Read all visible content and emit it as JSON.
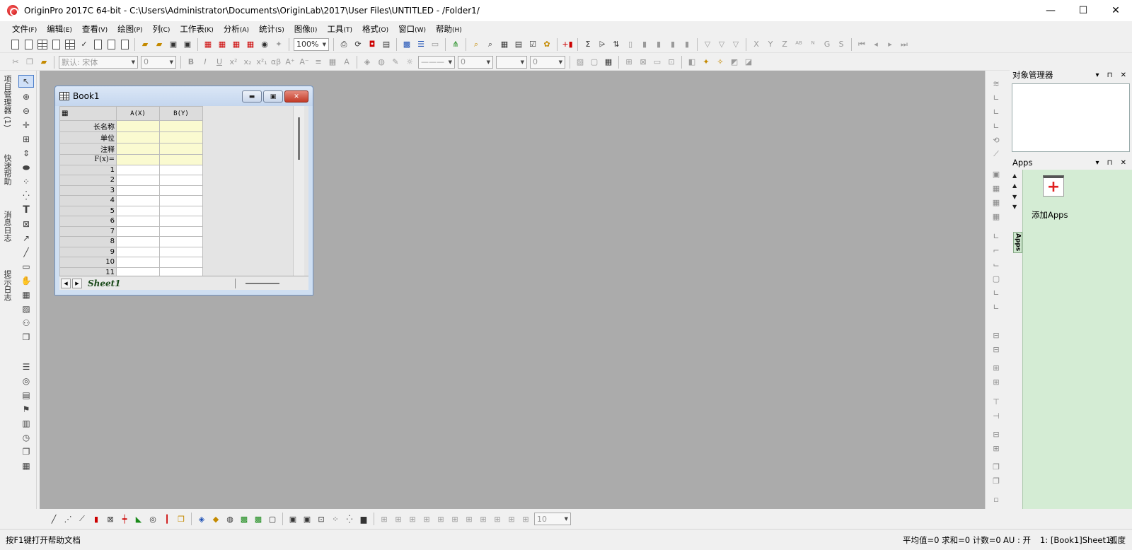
{
  "window": {
    "title": "OriginPro 2017C 64-bit - C:\\Users\\Administrator\\Documents\\OriginLab\\2017\\User Files\\UNTITLED - /Folder1/",
    "min": "—",
    "max": "☐",
    "close": "✕"
  },
  "menu": [
    {
      "label": "文件",
      "acc": "(F)"
    },
    {
      "label": "编辑",
      "acc": "(E)"
    },
    {
      "label": "查看",
      "acc": "(V)"
    },
    {
      "label": "绘图",
      "acc": "(P)"
    },
    {
      "label": "列",
      "acc": "(C)"
    },
    {
      "label": "工作表",
      "acc": "(K)"
    },
    {
      "label": "分析",
      "acc": "(A)"
    },
    {
      "label": "统计",
      "acc": "(S)"
    },
    {
      "label": "图像",
      "acc": "(I)"
    },
    {
      "label": "工具",
      "acc": "(T)"
    },
    {
      "label": "格式",
      "acc": "(O)"
    },
    {
      "label": "窗口",
      "acc": "(W)"
    },
    {
      "label": "帮助",
      "acc": "(H)"
    }
  ],
  "toolbar": {
    "zoom": "100%",
    "font_name": "默认: 宋体",
    "font_size": "0",
    "line_width": "0",
    "other_size": "0",
    "bottom_size": "10"
  },
  "left_tabs": [
    "项目管理器 (1)",
    "快速帮助",
    "消息日志",
    "提示日志"
  ],
  "object_manager": {
    "title": "对象管理器"
  },
  "apps": {
    "title": "Apps",
    "side_tab": "Apps",
    "add_label": "添加Apps"
  },
  "book": {
    "title": "Book1",
    "corner_label": "",
    "columns": [
      "A(X)",
      "B(Y)"
    ],
    "meta_rows": [
      "长名称",
      "单位",
      "注释",
      "F(x)="
    ],
    "rows": [
      "1",
      "2",
      "3",
      "4",
      "5",
      "6",
      "7",
      "8",
      "9",
      "10",
      "11"
    ],
    "sheet_tab": "Sheet1"
  },
  "status": {
    "help": "按F1键打开帮助文档",
    "stats": "平均值=0 求和=0 计数=0",
    "au": "AU : 开",
    "sheet": "1: [Book1]Sheet1!",
    "angle": "弧度"
  }
}
